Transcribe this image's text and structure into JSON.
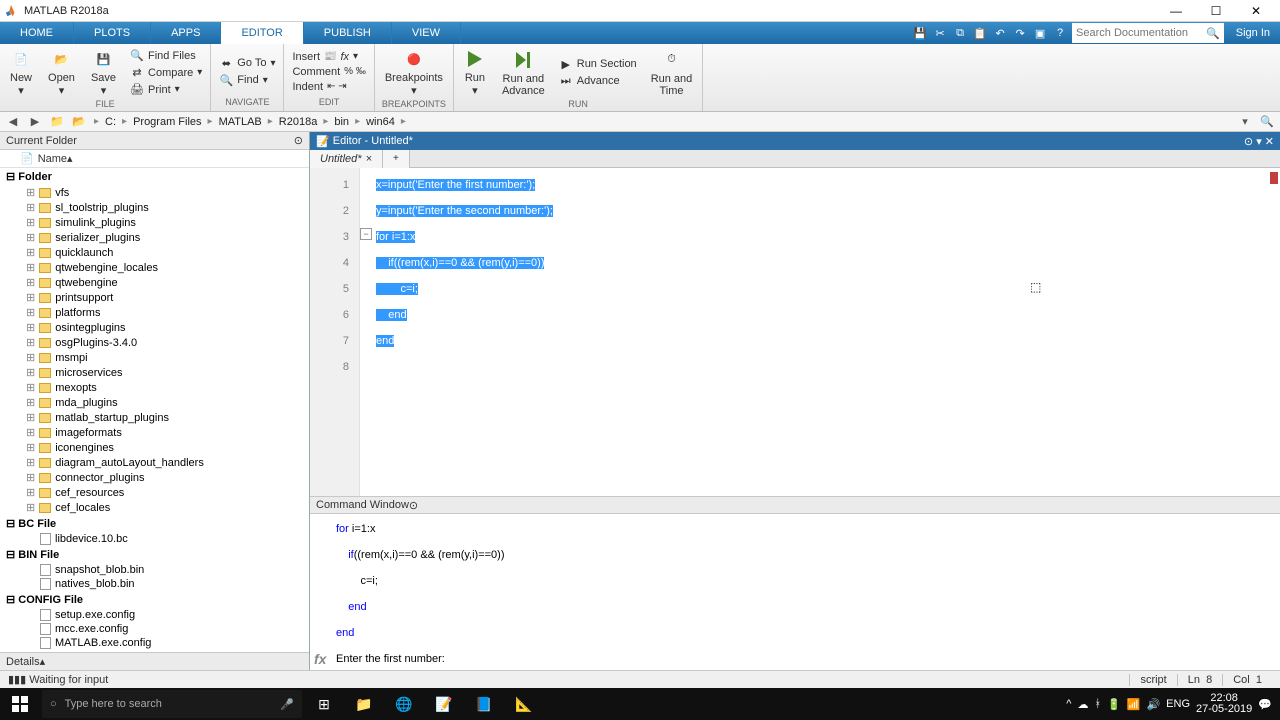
{
  "window": {
    "title": "MATLAB R2018a"
  },
  "tabs": {
    "home": "HOME",
    "plots": "PLOTS",
    "apps": "APPS",
    "editor": "EDITOR",
    "publish": "PUBLISH",
    "view": "VIEW"
  },
  "search": {
    "placeholder": "Search Documentation",
    "signin": "Sign In"
  },
  "ribbon": {
    "file": {
      "label": "FILE",
      "new": "New",
      "open": "Open",
      "save": "Save",
      "findfiles": "Find Files",
      "compare": "Compare",
      "print": "Print"
    },
    "navigate": {
      "label": "NAVIGATE",
      "goto": "Go To",
      "find": "Find"
    },
    "edit": {
      "label": "EDIT",
      "insert": "Insert",
      "comment": "Comment",
      "indent": "Indent"
    },
    "breakpoints": {
      "label": "BREAKPOINTS",
      "btn": "Breakpoints"
    },
    "run": {
      "label": "RUN",
      "run": "Run",
      "runadvance": "Run and\nAdvance",
      "runsection": "Run Section",
      "advance": "Advance",
      "runtime": "Run and\nTime"
    }
  },
  "path": {
    "c": "C:",
    "pf": "Program Files",
    "ml": "MATLAB",
    "ver": "R2018a",
    "bin": "bin",
    "win": "win64"
  },
  "currentFolder": {
    "title": "Current Folder",
    "namecol": "Name",
    "folderGroup": "Folder",
    "folders": [
      "vfs",
      "sl_toolstrip_plugins",
      "simulink_plugins",
      "serializer_plugins",
      "quicklaunch",
      "qtwebengine_locales",
      "qtwebengine",
      "printsupport",
      "platforms",
      "osintegplugins",
      "osgPlugins-3.4.0",
      "msmpi",
      "microservices",
      "mexopts",
      "mda_plugins",
      "matlab_startup_plugins",
      "imageformats",
      "iconengines",
      "diagram_autoLayout_handlers",
      "connector_plugins",
      "cef_resources",
      "cef_locales"
    ],
    "bcGroup": "BC File",
    "bcFiles": [
      "libdevice.10.bc"
    ],
    "binGroup": "BIN File",
    "binFiles": [
      "snapshot_blob.bin",
      "natives_blob.bin"
    ],
    "configGroup": "CONFIG File",
    "configFiles": [
      "setup.exe.config",
      "mcc.exe.config",
      "MATLAB.exe.config"
    ],
    "details": "Details"
  },
  "editor": {
    "title": "Editor - Untitled*",
    "tab": "Untitled*",
    "lines": [
      "x=input('Enter the first number:');",
      "y=input('Enter the second number:');",
      "for i=1:x",
      "    if((rem(x,i)==0 && (rem(y,i)==0))",
      "        c=i;",
      "    end",
      "end",
      ""
    ]
  },
  "commandWindow": {
    "title": "Command Window",
    "lines": [
      "for i=1:x",
      "    if((rem(x,i)==0 && (rem(y,i)==0))",
      "        c=i;",
      "    end",
      "end",
      "Enter the first number:"
    ]
  },
  "status": {
    "msg": "Waiting for input",
    "mode": "script",
    "ln": "Ln",
    "lnv": "8",
    "col": "Col",
    "colv": "1"
  },
  "taskbar": {
    "search": "Type here to search",
    "time": "22:08",
    "date": "27-05-2019",
    "lang": "ENG"
  }
}
